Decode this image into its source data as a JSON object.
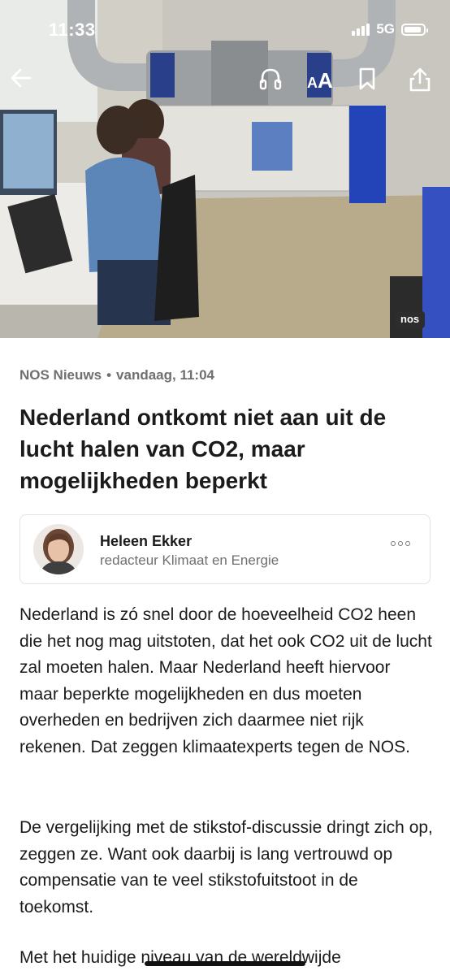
{
  "status": {
    "time": "11:33",
    "network": "5G"
  },
  "toolbar": {
    "back_icon": "arrow-left-icon",
    "listen_icon": "headphones-icon",
    "text_size_label_small": "A",
    "text_size_label_large": "A",
    "bookmark_icon": "bookmark-icon",
    "share_icon": "share-icon"
  },
  "hero": {
    "watermark": "nos"
  },
  "article": {
    "source": "NOS Nieuws",
    "separator": "•",
    "date": "vandaag, 11:04",
    "headline": "Nederland ontkomt niet aan uit de lucht halen van CO2, maar mogelijkheden beperkt",
    "author": {
      "name": "Heleen Ekker",
      "role": "redacteur Klimaat en Energie"
    },
    "paragraphs": [
      "Nederland is zó snel door de hoeveelheid CO2 heen die het nog mag uitstoten, dat het ook CO2 uit de lucht zal moeten halen. Maar Nederland heeft hiervoor maar beperkte mogelijkheden en dus moeten overheden en bedrijven zich daarmee niet rijk rekenen. Dat zeggen klimaatexperts tegen de NOS.",
      "De vergelijking met de stikstof-discussie dringt zich op, zeggen ze. Want ook daarbij is lang vertrouwd op compensatie van te veel stikstofuitstoot in de toekomst.",
      "Met het huidige niveau van de wereldwijde"
    ]
  },
  "colors": {
    "text": "#1b1b1b",
    "muted": "#6f6f6f",
    "border": "#e3e3e3"
  }
}
